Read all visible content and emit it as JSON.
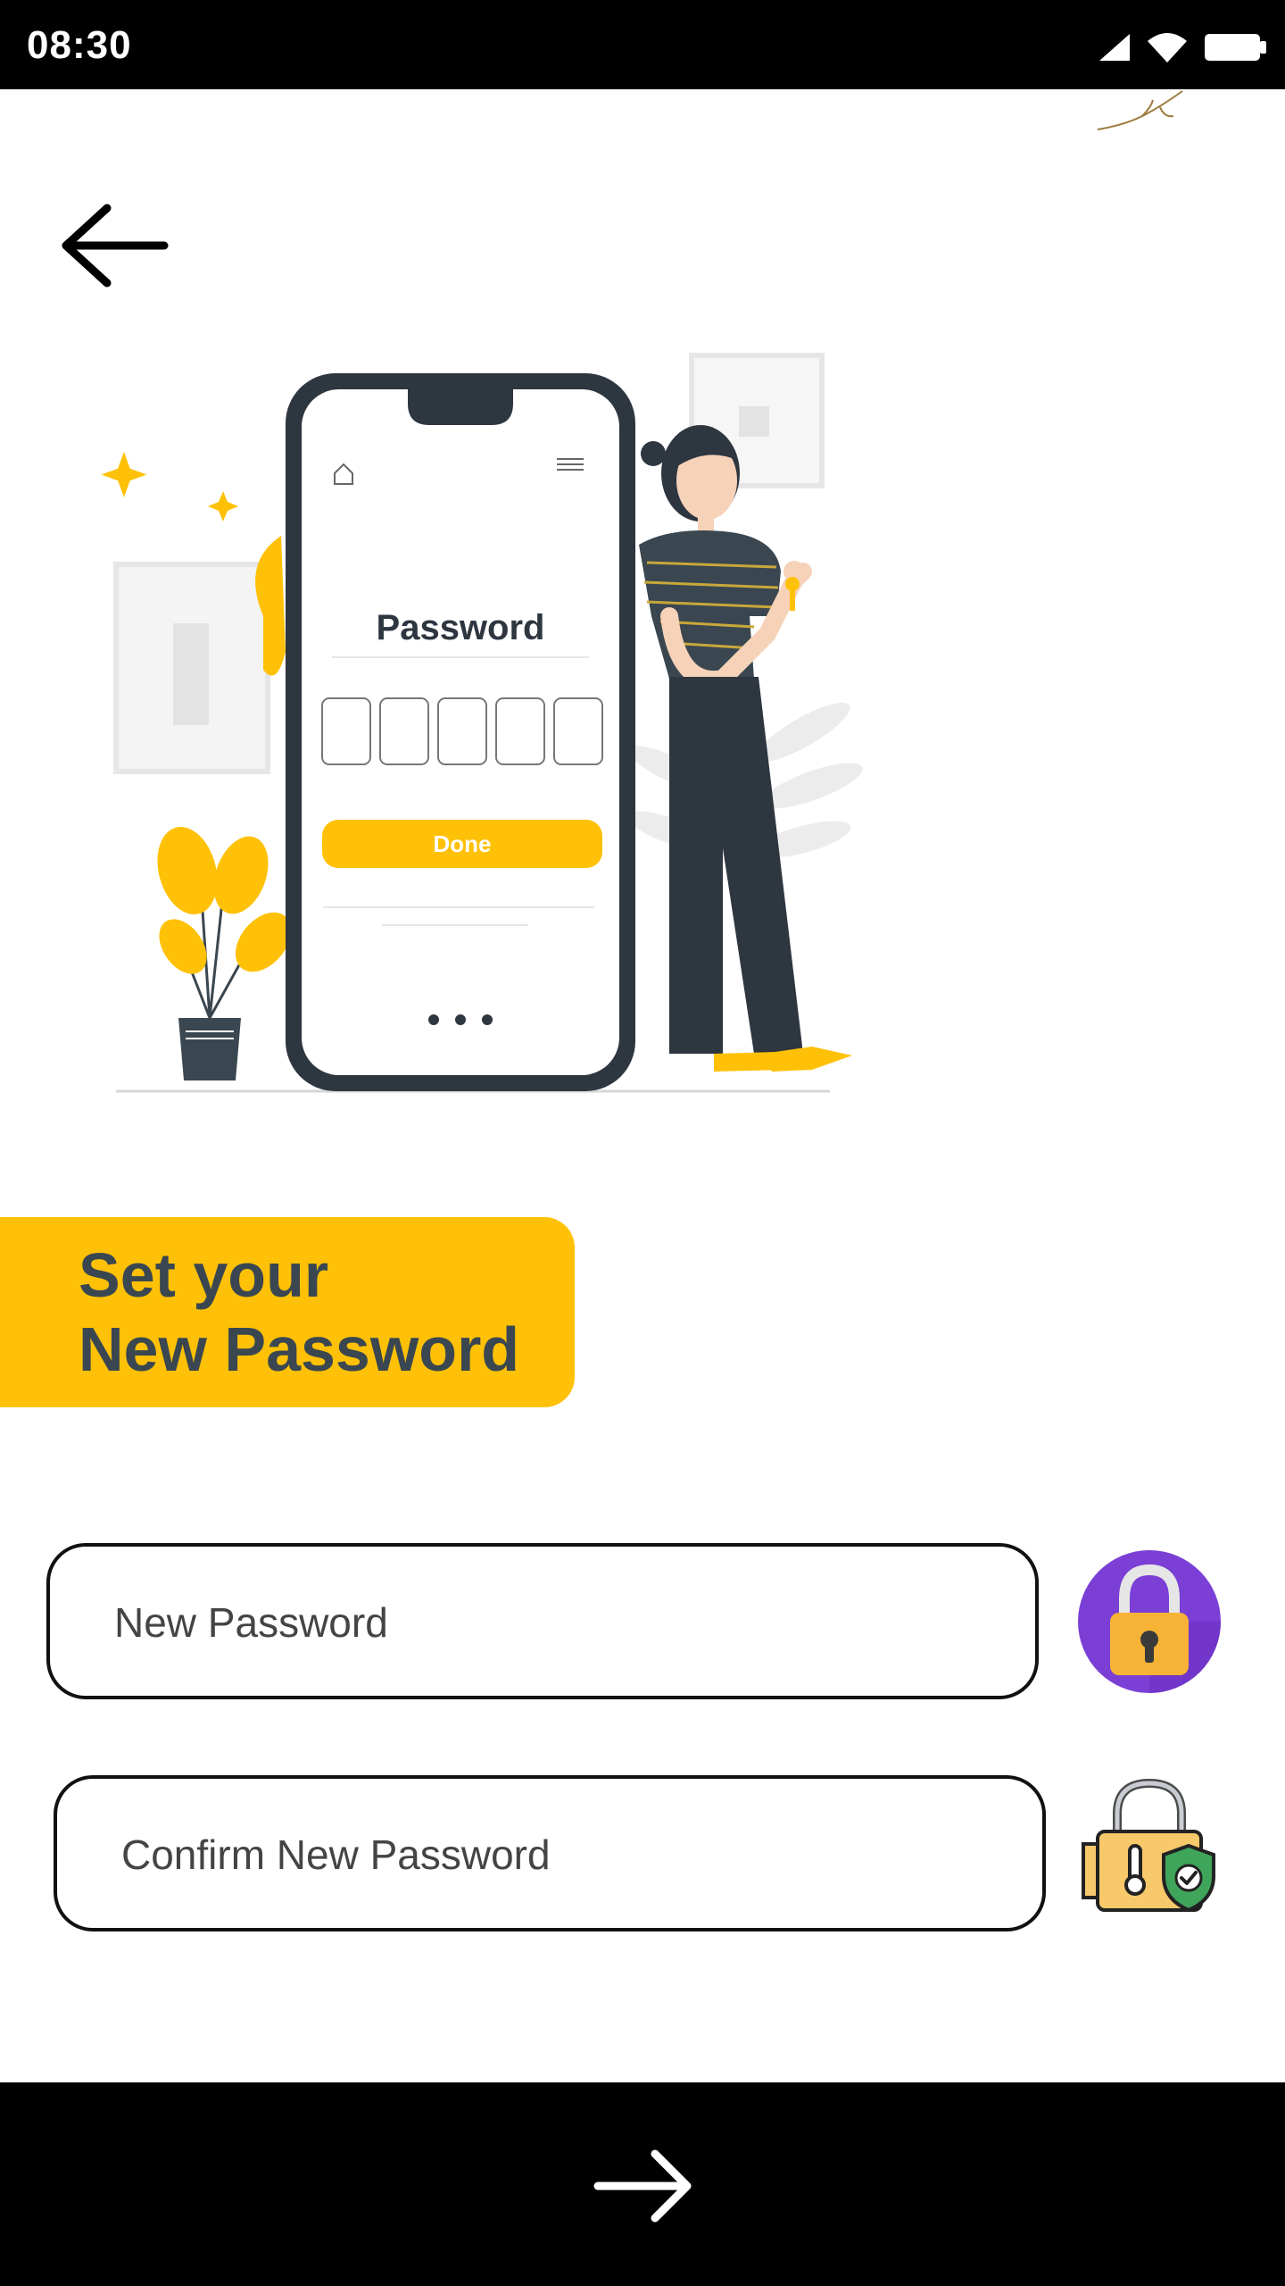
{
  "status_bar": {
    "time": "08:30",
    "icons": [
      "signal-icon",
      "wifi-icon",
      "battery-icon"
    ]
  },
  "nav": {
    "back_icon": "arrow-left-icon",
    "next_icon": "arrow-right-icon"
  },
  "illustration": {
    "phone_title": "Password",
    "phone_button": "Done",
    "code_boxes": 5
  },
  "heading": {
    "line1": "Set your",
    "line2": "New Password"
  },
  "form": {
    "new_password": {
      "placeholder": "New Password",
      "value": ""
    },
    "confirm_password": {
      "placeholder": "Confirm New Password",
      "value": ""
    }
  },
  "colors": {
    "accent": "#FFC107",
    "heading_text": "#3A4750",
    "lock_badge": "#7B3FD6",
    "shield": "#2E9E44"
  }
}
